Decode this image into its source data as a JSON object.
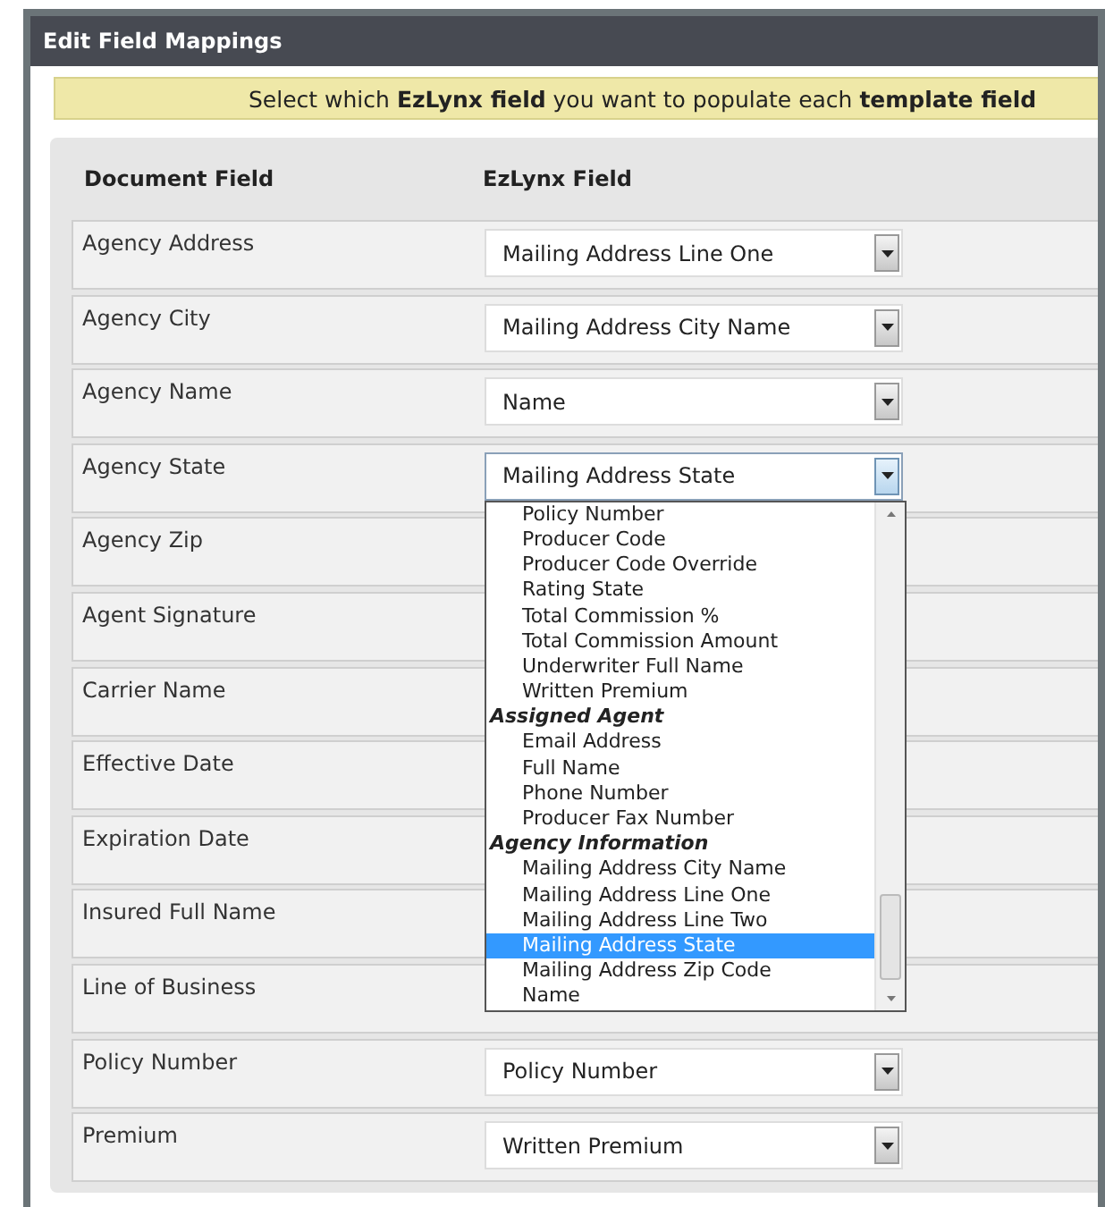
{
  "window": {
    "title": "Edit Field Mappings"
  },
  "banner": {
    "text": "Select which **EzLynx field** you want to populate each **template field**"
  },
  "columns": [
    "Document Field",
    "EzLynx Field"
  ],
  "rows": [
    {
      "label": "Agency Address",
      "value": "Mailing Address Line One",
      "open": false
    },
    {
      "label": "Agency City",
      "value": "Mailing Address City Name",
      "open": false
    },
    {
      "label": "Agency Name",
      "value": "Name",
      "open": false
    },
    {
      "label": "Agency State",
      "value": "Mailing Address State",
      "open": true
    },
    {
      "label": "Agency Zip"
    },
    {
      "label": "Agent Signature"
    },
    {
      "label": "Carrier Name"
    },
    {
      "label": "Effective Date"
    },
    {
      "label": "Expiration Date"
    },
    {
      "label": "Insured Full Name"
    },
    {
      "label": "Line of Business"
    },
    {
      "label": "Policy Number",
      "value": "Policy Number",
      "open": false
    },
    {
      "label": "Premium",
      "value": "Written Premium",
      "open": false
    }
  ],
  "dropdown": {
    "options": [
      {
        "kind": "option",
        "label": "Policy Number",
        "selected": false
      },
      {
        "kind": "option",
        "label": "Producer Code",
        "selected": false
      },
      {
        "kind": "option",
        "label": "Producer Code Override",
        "selected": false
      },
      {
        "kind": "option",
        "label": "Rating State",
        "selected": false
      },
      {
        "kind": "option",
        "label": "Total Commission %",
        "selected": false
      },
      {
        "kind": "option",
        "label": "Total Commission Amount",
        "selected": false
      },
      {
        "kind": "option",
        "label": "Underwriter Full Name",
        "selected": false
      },
      {
        "kind": "option",
        "label": "Written Premium",
        "selected": false
      },
      {
        "kind": "group",
        "label": "Assigned Agent"
      },
      {
        "kind": "option",
        "label": "Email Address",
        "selected": false
      },
      {
        "kind": "option",
        "label": "Full Name",
        "selected": false
      },
      {
        "kind": "option",
        "label": "Phone Number",
        "selected": false
      },
      {
        "kind": "option",
        "label": "Producer Fax Number",
        "selected": false
      },
      {
        "kind": "group",
        "label": "Agency Information"
      },
      {
        "kind": "option",
        "label": "Mailing Address City Name",
        "selected": false
      },
      {
        "kind": "option",
        "label": "Mailing Address Line One",
        "selected": false
      },
      {
        "kind": "option",
        "label": "Mailing Address Line Two",
        "selected": false
      },
      {
        "kind": "option",
        "label": "Mailing Address State",
        "selected": true
      },
      {
        "kind": "option",
        "label": "Mailing Address Zip Code",
        "selected": false
      },
      {
        "kind": "option",
        "label": "Name",
        "selected": false
      }
    ]
  }
}
